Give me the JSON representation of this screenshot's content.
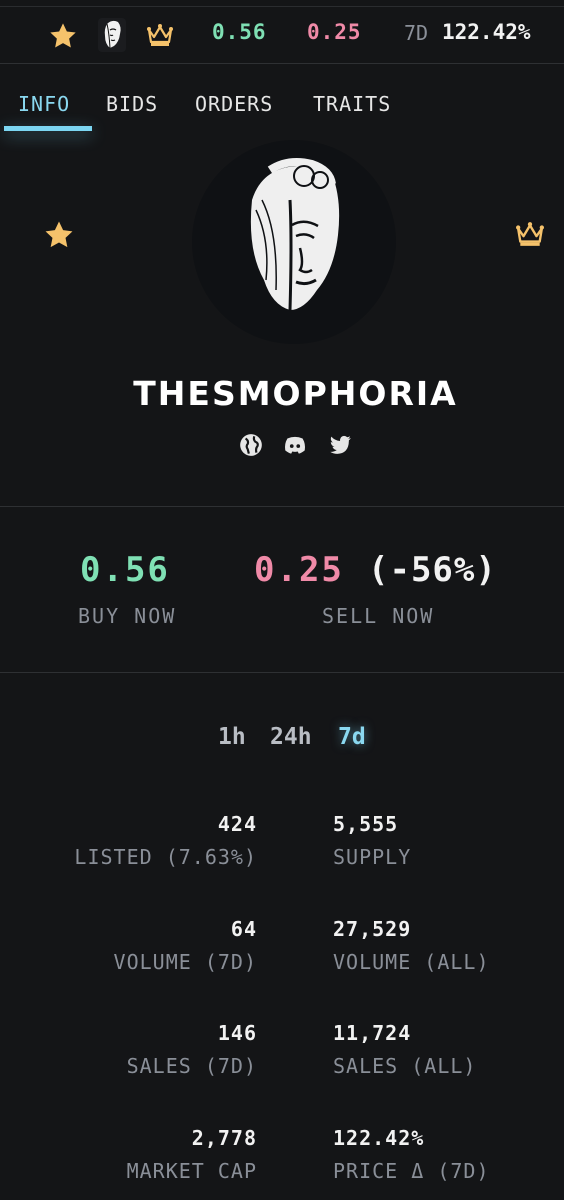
{
  "topbar": {
    "buy_price": "0.56",
    "sell_price": "0.25",
    "period": "7D",
    "change": "122.42%",
    "star_icon": "star-icon",
    "avatar": "collection-avatar",
    "crown_icon": "crown-icon"
  },
  "tabs": [
    {
      "label": "INFO",
      "active": true
    },
    {
      "label": "BIDS",
      "active": false
    },
    {
      "label": "ORDERS",
      "active": false
    },
    {
      "label": "TRAITS",
      "active": false
    }
  ],
  "collection": {
    "name": "THESMOPHORIA",
    "socials": [
      "globe-icon",
      "discord-icon",
      "twitter-icon"
    ]
  },
  "prices": {
    "buy": "0.56",
    "buy_label": "BUY NOW",
    "sell": "0.25",
    "sell_delta": "(-56%)",
    "sell_label": "SELL NOW"
  },
  "timeframes": [
    {
      "label": "1h",
      "active": false
    },
    {
      "label": "24h",
      "active": false
    },
    {
      "label": "7d",
      "active": true
    }
  ],
  "stats": [
    {
      "left_value": "424",
      "left_label": "LISTED (7.63%)",
      "right_value": "5,555",
      "right_label": "SUPPLY"
    },
    {
      "left_value": "64",
      "left_label": "VOLUME (7D)",
      "right_value": "27,529",
      "right_label": "VOLUME (ALL)"
    },
    {
      "left_value": "146",
      "left_label": "SALES (7D)",
      "right_value": "11,724",
      "right_label": "SALES (ALL)"
    },
    {
      "left_value": "2,778",
      "left_label": "MARKET CAP",
      "right_value": "122.42%",
      "right_label": "PRICE Δ (7D)"
    }
  ],
  "colors": {
    "background": "#141517",
    "buy": "#7fe0b4",
    "sell": "#f08aa8",
    "accent": "#7cd6f2",
    "muted": "#8a8f98",
    "star": "#f5c26b"
  }
}
